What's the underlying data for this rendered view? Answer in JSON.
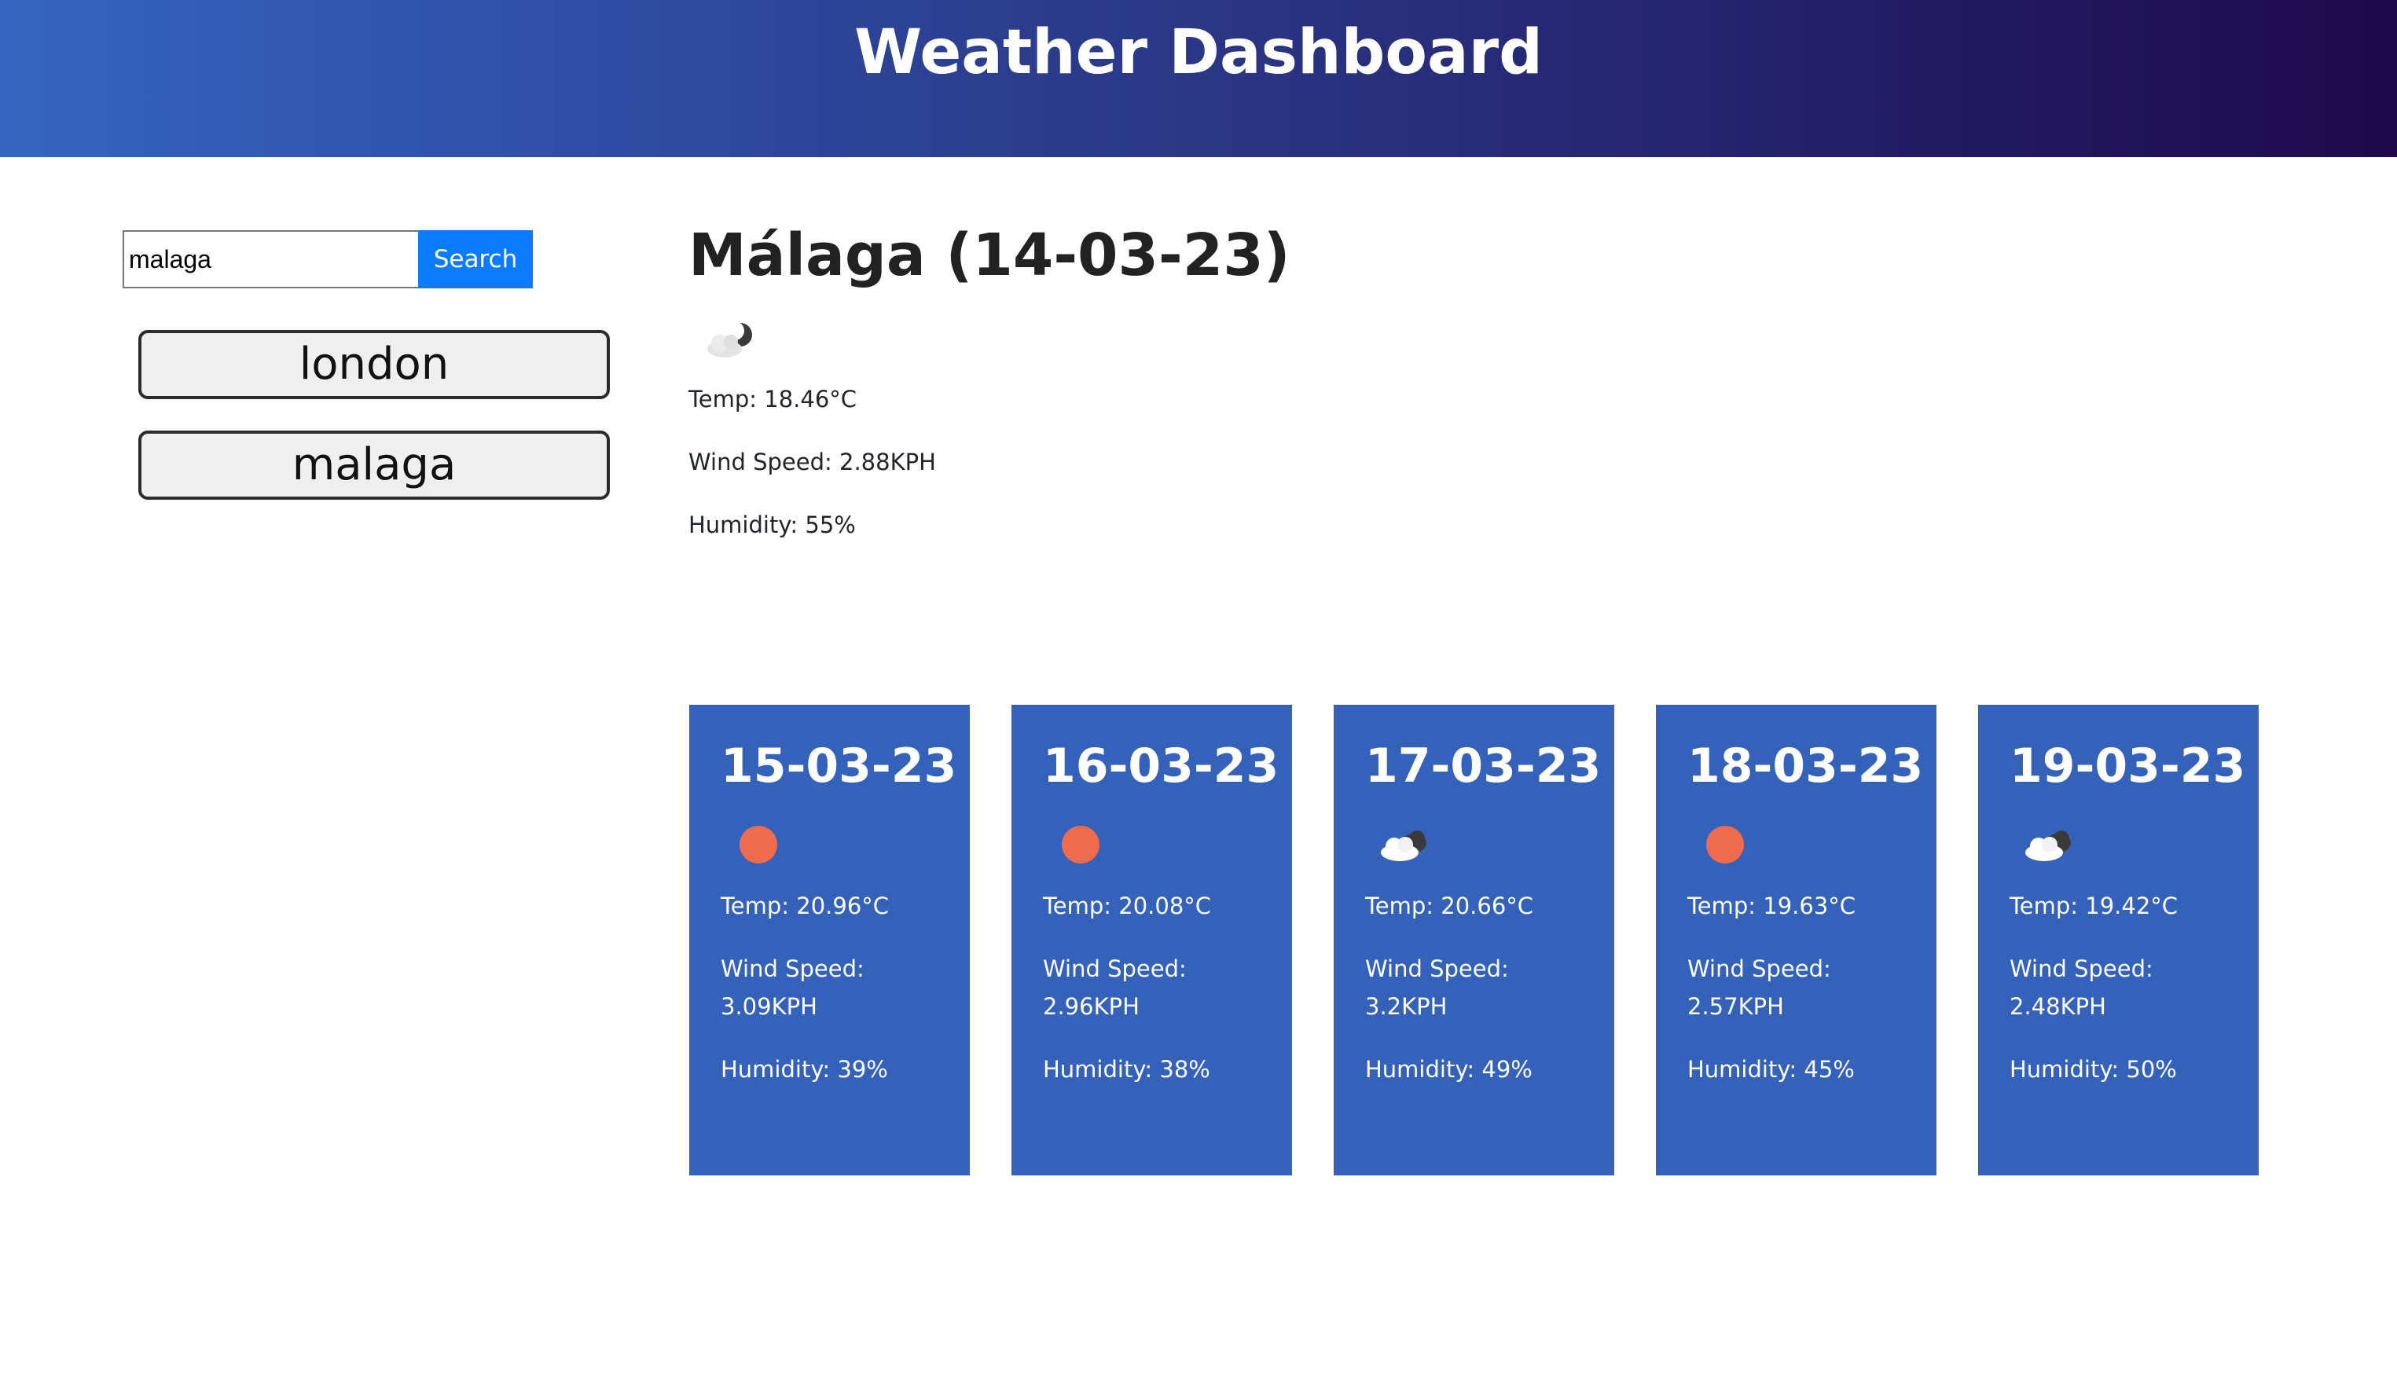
{
  "header": {
    "title": "Weather Dashboard"
  },
  "search": {
    "value": "malaga",
    "button_label": "Search"
  },
  "history": [
    {
      "label": "london"
    },
    {
      "label": "malaga"
    }
  ],
  "current": {
    "title": "Málaga (14-03-23)",
    "icon": "partly-cloudy-night-icon",
    "temp": "Temp: 18.46°C",
    "wind": "Wind Speed: 2.88KPH",
    "humidity": "Humidity: 55%"
  },
  "forecast": [
    {
      "date": "15-03-23",
      "icon": "sun-icon",
      "temp": "Temp: 20.96°C",
      "wind_label": "Wind Speed:",
      "wind_value": "3.09KPH",
      "humidity": "Humidity: 39%"
    },
    {
      "date": "16-03-23",
      "icon": "sun-icon",
      "temp": "Temp: 20.08°C",
      "wind_label": "Wind Speed:",
      "wind_value": "2.96KPH",
      "humidity": "Humidity: 38%"
    },
    {
      "date": "17-03-23",
      "icon": "cloudy-icon",
      "temp": "Temp: 20.66°C",
      "wind_label": "Wind Speed:",
      "wind_value": "3.2KPH",
      "humidity": "Humidity: 49%"
    },
    {
      "date": "18-03-23",
      "icon": "sun-icon",
      "temp": "Temp: 19.63°C",
      "wind_label": "Wind Speed:",
      "wind_value": "2.57KPH",
      "humidity": "Humidity: 45%"
    },
    {
      "date": "19-03-23",
      "icon": "cloudy-icon",
      "temp": "Temp: 19.42°C",
      "wind_label": "Wind Speed:",
      "wind_value": "2.48KPH",
      "humidity": "Humidity: 50%"
    }
  ],
  "colors": {
    "header_start": "#3465c0",
    "header_end": "#1e0a4c",
    "card_background": "#3462bb",
    "search_button": "#0b7bff",
    "sun": "#ee6c4d"
  }
}
